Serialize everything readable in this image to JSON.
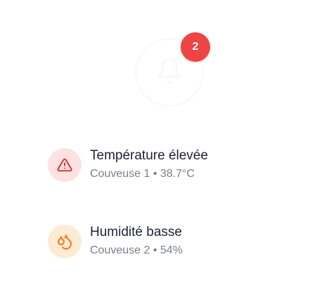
{
  "notifications": {
    "count": "2",
    "icons": {
      "bell": "bell-icon"
    },
    "colors": {
      "badge": "#ef4444",
      "warning": "#dc2626",
      "humidity": "#f97316"
    }
  },
  "alerts": [
    {
      "icon": "warning-triangle-icon",
      "title": "Température élevée",
      "subtitle": "Couveuse 1 • 38.7°C"
    },
    {
      "icon": "water-drops-icon",
      "title": "Humidité basse",
      "subtitle": "Couveuse 2 • 54%"
    }
  ]
}
